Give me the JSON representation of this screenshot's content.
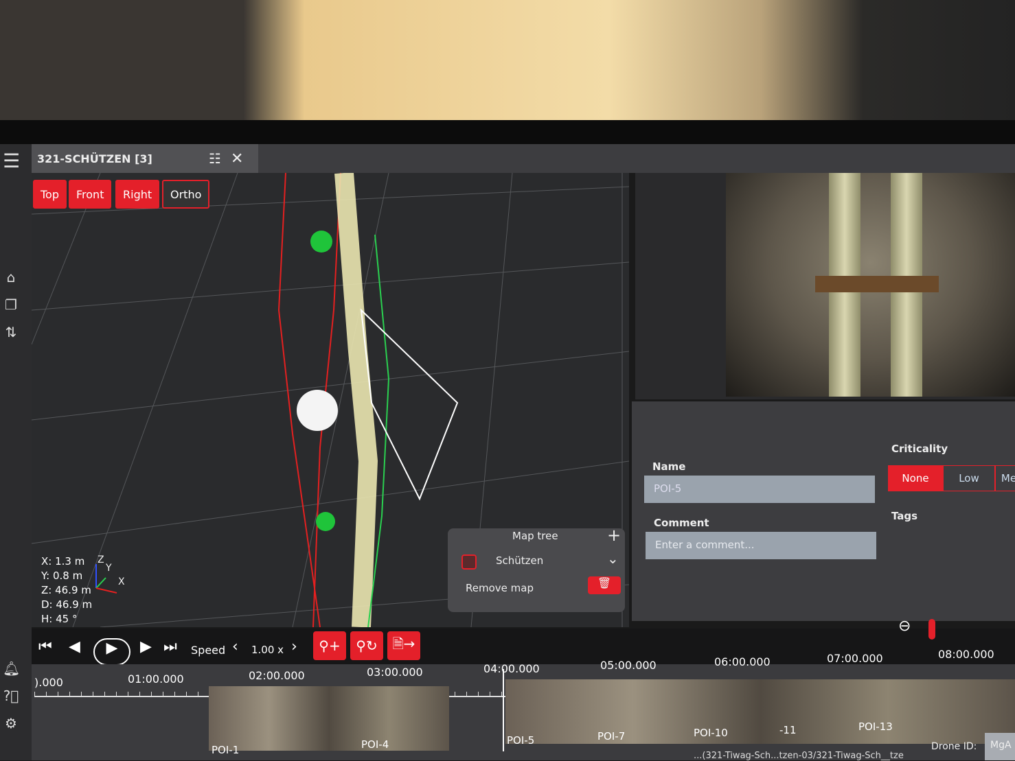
{
  "tab": {
    "title": "321-SCHÜTZEN [3]"
  },
  "view_buttons": [
    {
      "label": "Top"
    },
    {
      "label": "Front"
    },
    {
      "label": "Right"
    },
    {
      "label": "Ortho"
    }
  ],
  "coords": {
    "x": "X:  1.3 m",
    "y": "Y:  0.8 m",
    "z": "Z: 46.9 m",
    "d": "D: 46.9 m",
    "h": "H:   45 °"
  },
  "axes": {
    "x": "X",
    "y": "Y",
    "z": "Z"
  },
  "map_tree": {
    "title": "Map tree",
    "item": "Schützen",
    "remove": "Remove map"
  },
  "form": {
    "name_label": "Name",
    "name_value": "POI-5",
    "comment_label": "Comment",
    "comment_placeholder": "Enter a comment...",
    "criticality_label": "Criticality",
    "criticality_options": [
      "None",
      "Low",
      "Me"
    ],
    "criticality_selected": "None",
    "tags_label": "Tags"
  },
  "playback": {
    "speed_label": "Speed",
    "speed_value": "1.00 x"
  },
  "timeline": {
    "ticks": [
      ").000",
      "01:00.000",
      "02:00.000",
      "03:00.000",
      "04:00.000",
      "05:00.000",
      "06:00.000",
      "07:00.000",
      "08:00.000"
    ],
    "pois": [
      "POI-1",
      "POI-4",
      "POI-5",
      "POI-7",
      "POI-10",
      "-11",
      "POI-13"
    ]
  },
  "footer": {
    "drone_id_label": "Drone ID:",
    "drone_id_value": "MgA",
    "path": "...(321-Tiwag-Sch...tzen-03/321-Tiwag-Sch__tze"
  },
  "colors": {
    "accent": "#e4202a",
    "panel": "#3d3d40",
    "viewer": "#2a2b2d"
  }
}
